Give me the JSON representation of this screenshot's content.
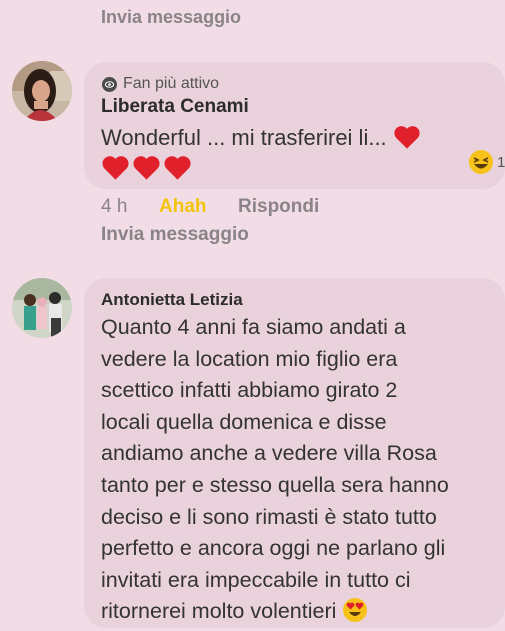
{
  "top_link": {
    "label": "Invia messaggio"
  },
  "comment1": {
    "badge": "Fan più attivo",
    "author": "Liberata Cenami",
    "text": "Wonderful ... mi trasferirei li...",
    "reaction_count": "1",
    "time": "4 h",
    "reaction_label": "Ahah",
    "reply_label": "Rispondi",
    "send_message_label": "Invia messaggio"
  },
  "comment2": {
    "author": "Antonietta Letizia",
    "lines": [
      "Quanto 4 anni fa siamo andati a",
      "vedere la location mio figlio era",
      "scettico infatti abbiamo girato 2",
      "locali quella domenica e disse",
      "andiamo anche a vedere villa Rosa",
      "tanto per e stesso quella sera hanno",
      "deciso e li sono rimasti è stato tutto",
      "perfetto e ancora oggi ne parlano gli",
      "invitati era impeccabile in tutto ci",
      "ritornerei molto volentieri"
    ]
  },
  "colors": {
    "background": "#f2dde6",
    "bubble": "#ead2dc",
    "reaction_yellow": "#f2c40d",
    "heart_red": "#e0202a"
  },
  "icons": {
    "badge": "eye-icon",
    "heart": "red-heart-emoji",
    "laugh": "laughing-emoji",
    "heart_eyes": "heart-eyes-emoji"
  }
}
